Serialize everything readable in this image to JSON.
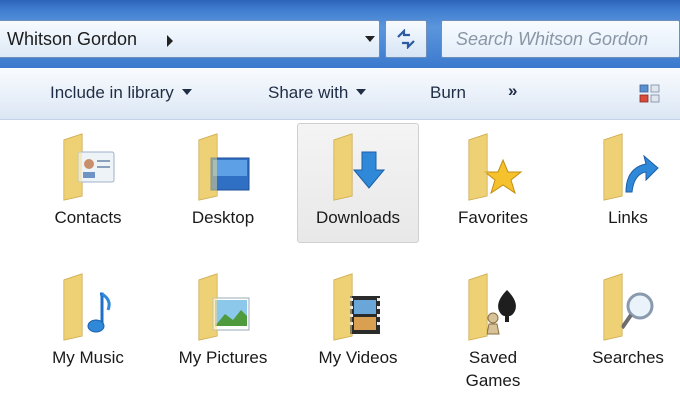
{
  "address": {
    "path_segment": "Whitson Gordon",
    "search_placeholder": "Search Whitson Gordon"
  },
  "toolbar": {
    "include_label": "Include in library",
    "share_label": "Share with",
    "burn_label": "Burn",
    "more_label": "»"
  },
  "folders": [
    {
      "label": "Contacts",
      "icon": "contacts-folder-icon"
    },
    {
      "label": "Desktop",
      "icon": "desktop-folder-icon"
    },
    {
      "label": "Downloads",
      "icon": "downloads-folder-icon",
      "selected": true
    },
    {
      "label": "Favorites",
      "icon": "favorites-folder-icon"
    },
    {
      "label": "Links",
      "icon": "links-folder-icon"
    },
    {
      "label": "My Music",
      "icon": "music-folder-icon"
    },
    {
      "label": "My Pictures",
      "icon": "pictures-folder-icon"
    },
    {
      "label": "My Videos",
      "icon": "videos-folder-icon"
    },
    {
      "label": "Saved Games",
      "icon": "saved-games-folder-icon"
    },
    {
      "label": "Searches",
      "icon": "searches-folder-icon"
    }
  ],
  "colors": {
    "chrome_blue": "#3f7dd0",
    "folder_yellow": "#f2d77a",
    "selection_gray": "#ececec"
  }
}
